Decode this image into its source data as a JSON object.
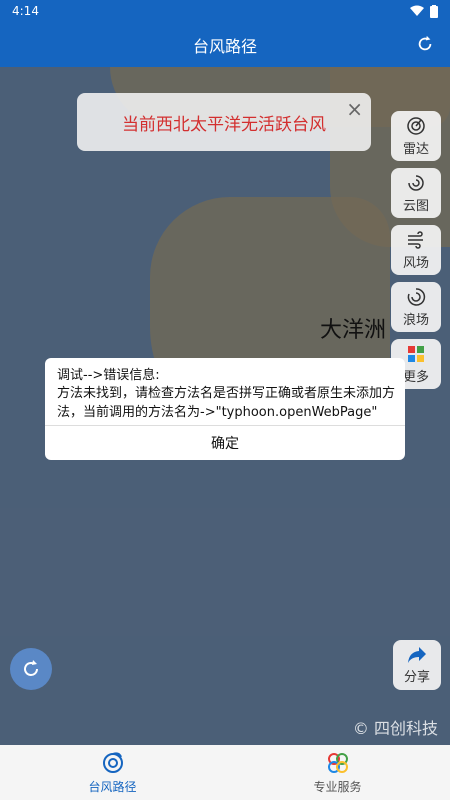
{
  "status_bar": {
    "time": "4:14"
  },
  "app_bar": {
    "title": "台风路径"
  },
  "notice": {
    "text": "当前西北太平洋无活跃台风",
    "close": "×"
  },
  "side_buttons": [
    {
      "label": "雷达",
      "icon": "radar-icon"
    },
    {
      "label": "云图",
      "icon": "cloud-icon"
    },
    {
      "label": "风场",
      "icon": "wind-icon"
    },
    {
      "label": "浪场",
      "icon": "wave-icon"
    },
    {
      "label": "更多",
      "icon": "grid-icon"
    }
  ],
  "map": {
    "ocean_label": "大洋洲",
    "watermark": "© 四创科技"
  },
  "share": {
    "label": "分享"
  },
  "dialog": {
    "title": "调试-->错误信息:",
    "message": "方法未找到，请检查方法名是否拼写正确或者原生未添加方法，当前调用的方法名为->\"typhoon.openWebPage\"",
    "ok": "确定"
  },
  "bottom_nav": [
    {
      "label": "台风路径",
      "active": true
    },
    {
      "label": "专业服务",
      "active": false
    }
  ],
  "colors": {
    "primary": "#1565c0",
    "notice_text": "#d32f2f"
  }
}
